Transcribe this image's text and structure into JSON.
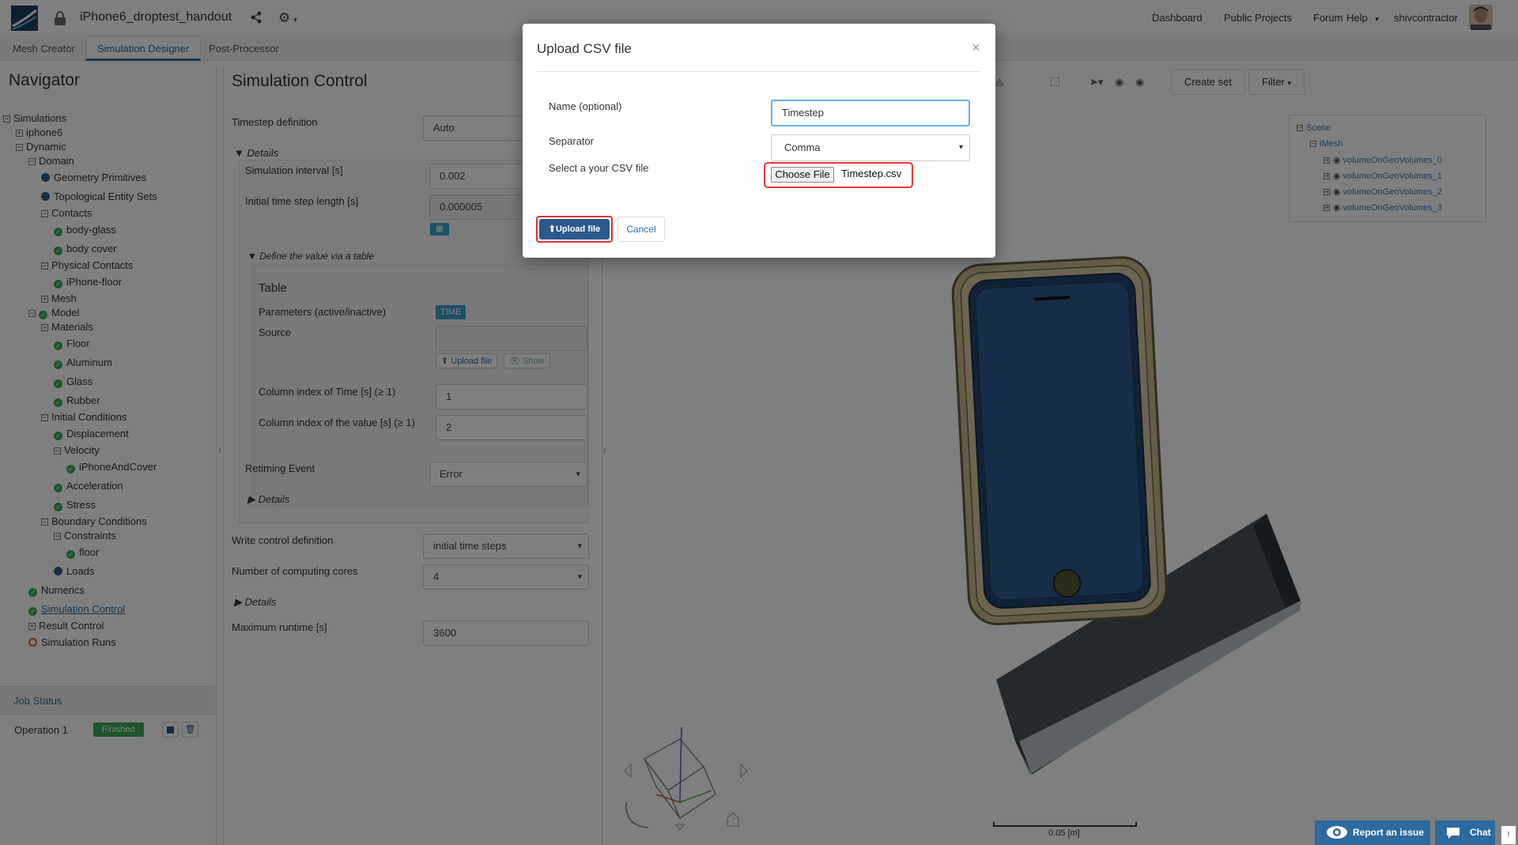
{
  "topbar": {
    "project_title": "iPhone6_droptest_handout",
    "nav": [
      "Dashboard",
      "Public Projects",
      "Forum",
      "Help"
    ],
    "user": "shivcontractor"
  },
  "tabs": [
    "Mesh Creator",
    "Simulation Designer",
    "Post-Processor"
  ],
  "navigator": {
    "title": "Navigator",
    "tree": {
      "simulations": "Simulations",
      "iphone6": "iphone6",
      "dynamic": "Dynamic",
      "domain": "Domain",
      "geometry_primitives": "Geometry Primitives",
      "topological_entity_sets": "Topological Entity Sets",
      "contacts": "Contacts",
      "body_glass": "body-glass",
      "body_cover": "body cover",
      "physical_contacts": "Physical Contacts",
      "iphone_floor": "iPhone-floor",
      "mesh": "Mesh",
      "model": "Model",
      "materials": "Materials",
      "floor": "Floor",
      "aluminum": "Aluminum",
      "glass": "Glass",
      "rubber": "Rubber",
      "initial_conditions": "Initial Conditions",
      "displacement": "Displacement",
      "velocity": "Velocity",
      "iphone_and_cover": "iPhoneAndCover",
      "acceleration": "Acceleration",
      "stress": "Stress",
      "boundary_conditions": "Boundary Conditions",
      "constraints": "Constraints",
      "floor_constraint": "floor",
      "loads": "Loads",
      "numerics": "Numerics",
      "simulation_control": "Simulation Control",
      "result_control": "Result Control",
      "simulation_runs": "Simulation Runs"
    },
    "job_status": {
      "title": "Job Status",
      "operation": "Operation 1",
      "status": "Finished"
    }
  },
  "sim_control": {
    "title": "Simulation Control",
    "timestep_definition_label": "Timestep definition",
    "timestep_definition_value": "Auto",
    "details_label": "Details",
    "simulation_interval_label": "Simulation interval [s]",
    "simulation_interval_value": "0.002",
    "initial_step_label": "Initial time step length [s]",
    "initial_step_value": "0.000005",
    "define_table_label": "Define the value via a table",
    "table_title": "Table",
    "parameters_label": "Parameters (active/inactive)",
    "parameters_tag": "TIME",
    "source_label": "Source",
    "upload_file_label": "Upload file",
    "show_label": "Show",
    "col_time_label": "Column index of Time [s] (≥ 1)",
    "col_time_value": "1",
    "col_value_label": "Column index of the value [s] (≥ 1)",
    "col_value_value": "2",
    "retiming_label": "Retiming Event",
    "retiming_value": "Error",
    "details2_label": "Details",
    "write_control_label": "Write control definition",
    "write_control_value": "initial time steps",
    "cores_label": "Number of computing cores",
    "cores_value": "4",
    "details3_label": "Details",
    "max_runtime_label": "Maximum runtime [s]",
    "max_runtime_value": "3600"
  },
  "viewer": {
    "create_set": "Create set",
    "filter": "Filter",
    "scene_tree": {
      "scene": "Scene",
      "imesh": "iMesh",
      "volumes": [
        "volumeOnGeoVolumes_0",
        "volumeOnGeoVolumes_1",
        "volumeOnGeoVolumes_2",
        "volumeOnGeoVolumes_3"
      ]
    },
    "scale_label": "0.05 [m]"
  },
  "modal": {
    "title": "Upload CSV file",
    "close": "×",
    "name_label": "Name (optional)",
    "name_value": "Timestep",
    "separator_label": "Separator",
    "separator_value": "Comma",
    "file_label": "Select a your CSV file",
    "choose_file": "Choose File",
    "file_name": "Timestep.csv",
    "upload_button": "Upload file",
    "cancel_button": "Cancel"
  },
  "footer": {
    "report": "Report an issue",
    "chat": "Chat"
  }
}
